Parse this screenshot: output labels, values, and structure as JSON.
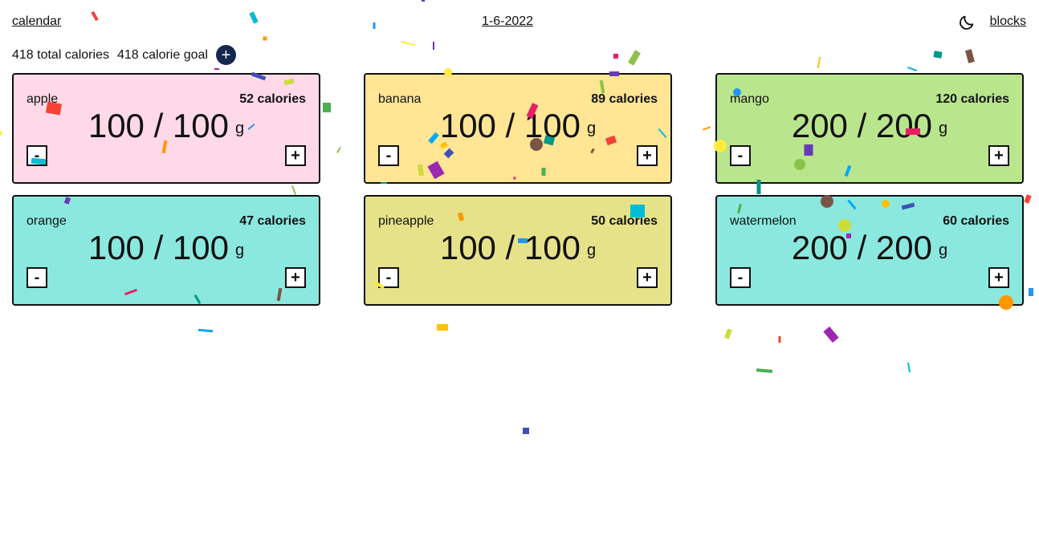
{
  "header": {
    "calendar_label": "calendar",
    "date_label": "1-6-2022",
    "blocks_label": "blocks",
    "theme_icon": "moon-icon"
  },
  "summary": {
    "total_calories": "418 total calories",
    "calorie_goal": "418 calorie goal",
    "add_label": "+"
  },
  "foods": [
    {
      "name": "apple",
      "calories": "52 calories",
      "amount": "100 / 100",
      "unit": "g",
      "color": "#ffd9e8",
      "minus": "-",
      "plus": "+"
    },
    {
      "name": "banana",
      "calories": "89 calories",
      "amount": "100 / 100",
      "unit": "g",
      "color": "#ffe594",
      "minus": "-",
      "plus": "+"
    },
    {
      "name": "mango",
      "calories": "120 calories",
      "amount": "200 / 200",
      "unit": "g",
      "color": "#b9e58d",
      "minus": "-",
      "plus": "+"
    },
    {
      "name": "orange",
      "calories": "47 calories",
      "amount": "100 / 100",
      "unit": "g",
      "color": "#8be8de",
      "minus": "-",
      "plus": "+"
    },
    {
      "name": "pineapple",
      "calories": "50 calories",
      "amount": "100 / 100",
      "unit": "g",
      "color": "#e6e28a",
      "minus": "-",
      "plus": "+"
    },
    {
      "name": "watermelon",
      "calories": "60 calories",
      "amount": "200 / 200",
      "unit": "g",
      "color": "#8be8de",
      "minus": "-",
      "plus": "+"
    }
  ],
  "confetti_colors": [
    "#f44336",
    "#e91e63",
    "#9c27b0",
    "#673ab7",
    "#3f51b5",
    "#2196f3",
    "#03a9f4",
    "#00bcd4",
    "#009688",
    "#4caf50",
    "#8bc34a",
    "#cddc39",
    "#ffeb3b",
    "#ffc107",
    "#ff9800",
    "#795548"
  ]
}
